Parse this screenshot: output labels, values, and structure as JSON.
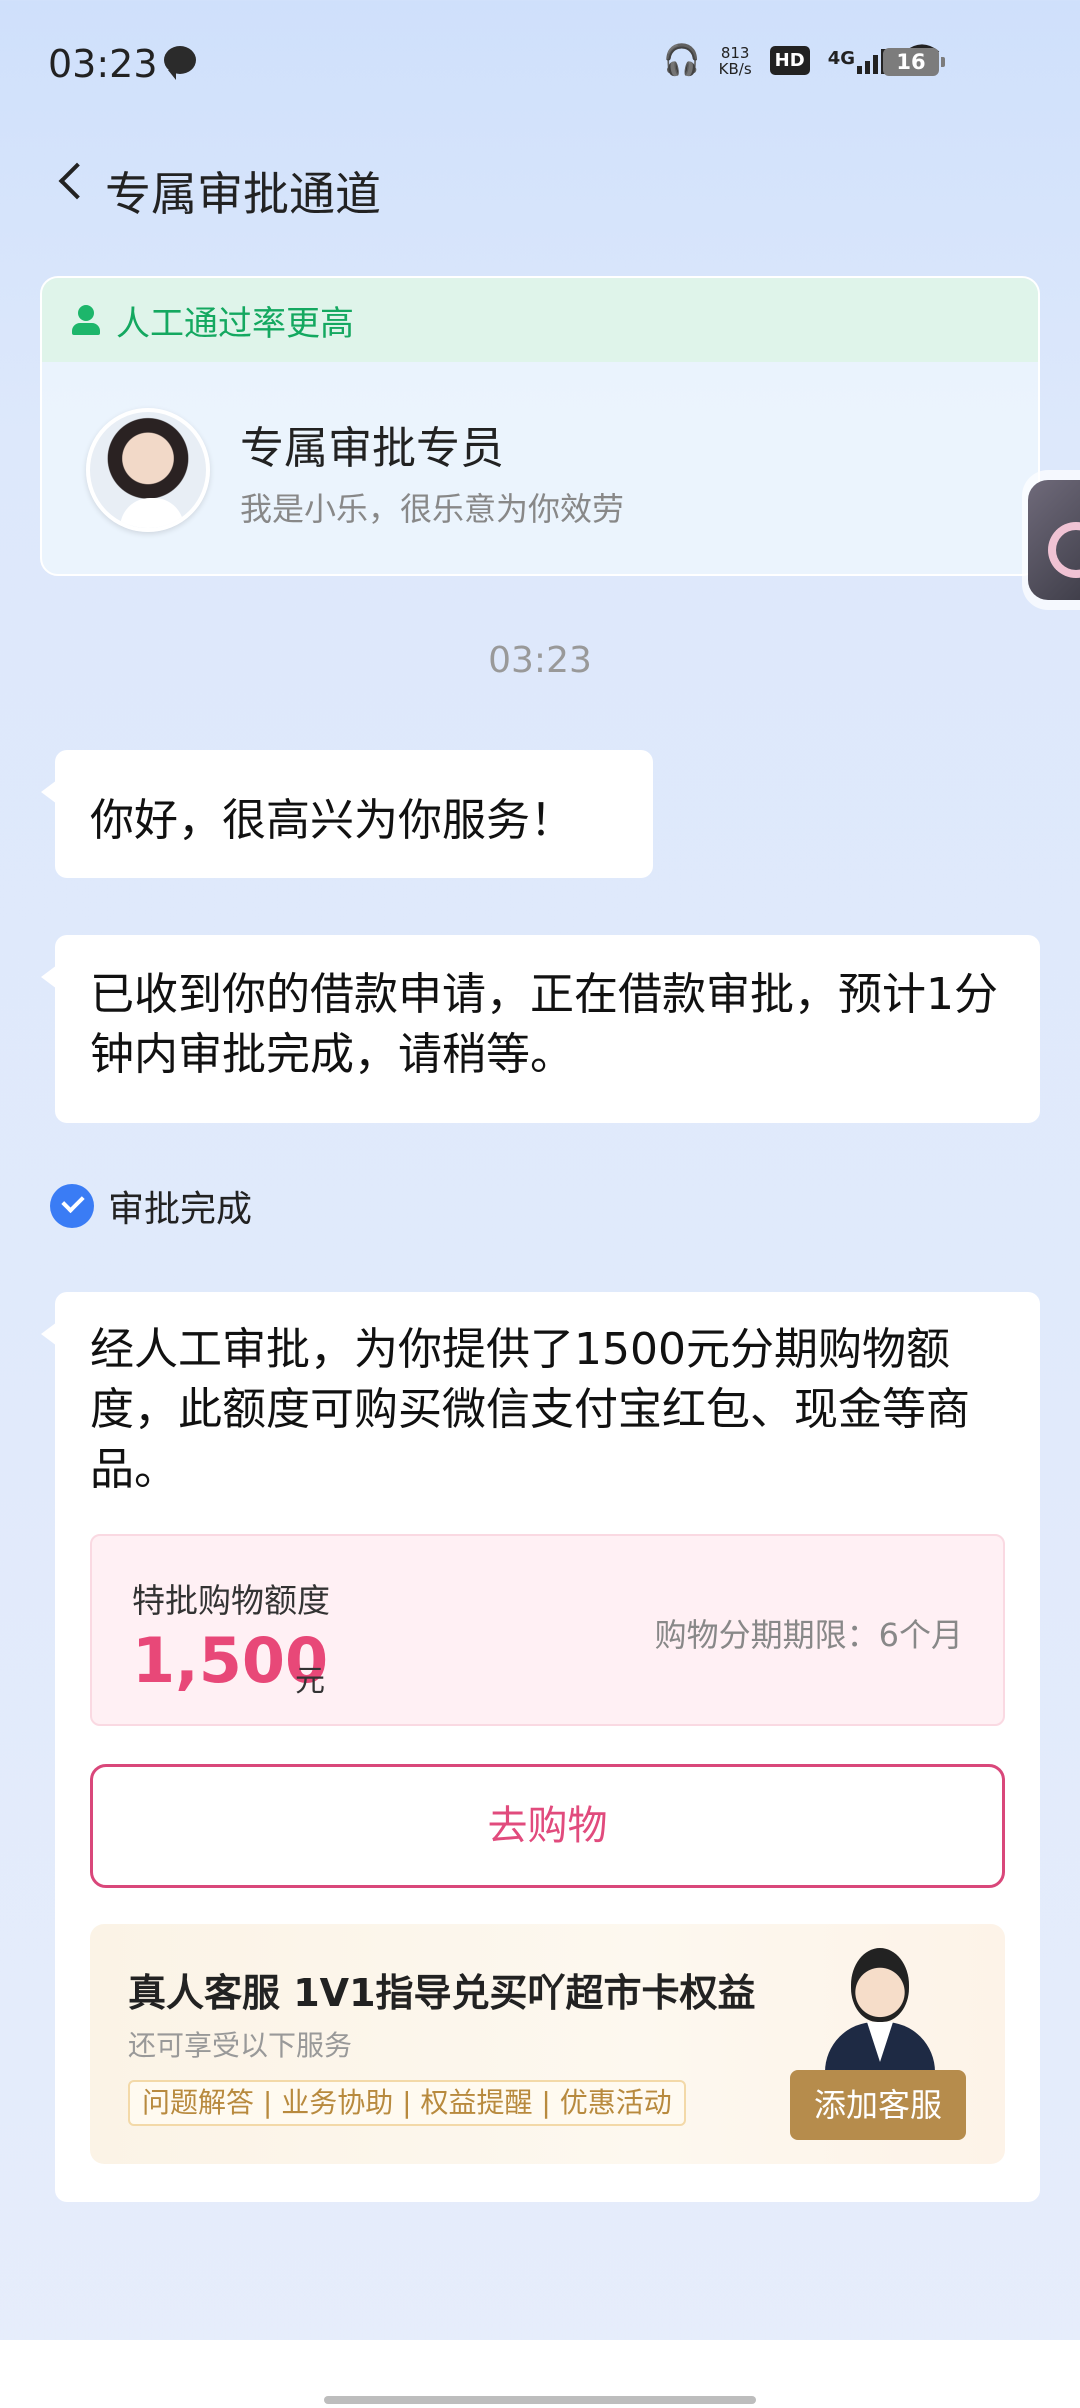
{
  "status_bar": {
    "time": "03:23",
    "net_speed_value": "813",
    "net_speed_unit": "KB/s",
    "hd_label": "HD",
    "network_label": "4G",
    "battery_level": "16"
  },
  "header": {
    "title": "专属审批通道"
  },
  "agent_card": {
    "banner": "人工通过率更高",
    "name": "专属审批专员",
    "description": "我是小乐，很乐意为你效劳"
  },
  "chat": {
    "timestamp": "03:23",
    "messages": [
      {
        "text": "你好，很高兴为你服务！"
      },
      {
        "text": "已收到你的借款申请，正在借款审批，预计1分钟内审批完成，请稍等。"
      }
    ],
    "status": "审批完成",
    "result_message": "经人工审批，为你提供了1500元分期购物额度，此额度可购买微信支付宝红包、现金等商品。",
    "quota": {
      "label": "特批购物额度",
      "amount": "1,500",
      "unit": "元",
      "term": "购物分期期限：6个月"
    },
    "shop_button": "去购物",
    "service": {
      "title": "真人客服 1V1指导兑买吖超市卡权益",
      "subtitle": "还可享受以下服务",
      "tags": "问题解答 | 业务协助 | 权益提醒 | 优惠活动",
      "button": "添加客服"
    }
  }
}
